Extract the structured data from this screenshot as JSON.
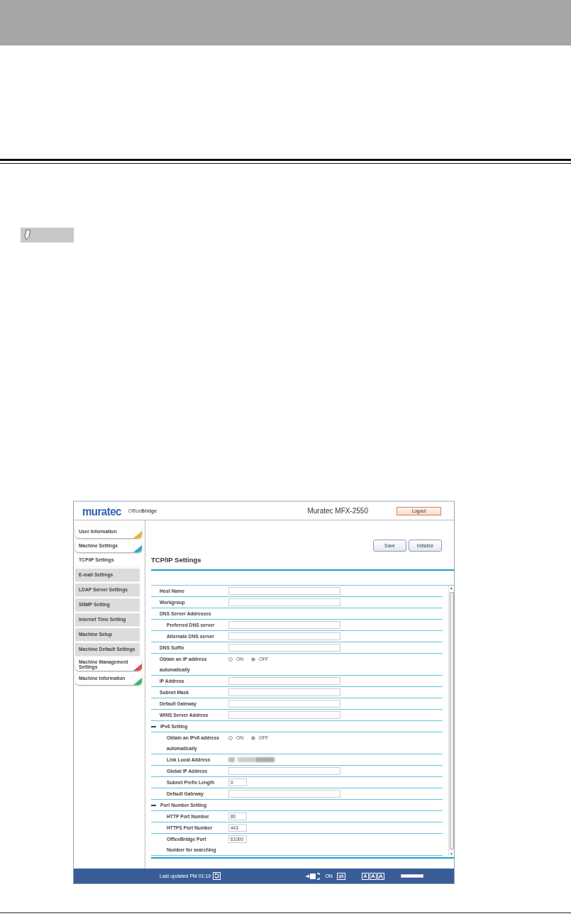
{
  "window": {
    "logo": "muratec",
    "product": "Office**Bridge**",
    "model": "Muratec MFX-2550",
    "logout": "Logout"
  },
  "sidebar": [
    {
      "label": "User Information",
      "color": "#efb12e"
    },
    {
      "label": "Machine Settings",
      "color": "#2ea9cb",
      "children": [
        {
          "label": "TCP/IP Settings",
          "selected": true
        },
        {
          "label": "E-mail Settings",
          "selected": false
        },
        {
          "label": "LDAP Server Settings",
          "selected": false
        },
        {
          "label": "SNMP Setting",
          "selected": false
        },
        {
          "label": "Internet Time Setting",
          "selected": false
        },
        {
          "label": "Machine Setup",
          "selected": false
        },
        {
          "label": "Machine Default Settings",
          "selected": false
        }
      ]
    },
    {
      "label": "Machine Management Settings",
      "color": "#dd4f4f"
    },
    {
      "label": "Machine Information",
      "color": "#3fb56a"
    }
  ],
  "buttons": [
    "Save",
    "Initialize"
  ],
  "title": "TCP/IP Settings",
  "rows": [
    {
      "kind": "field",
      "label": "Host Name"
    },
    {
      "kind": "field",
      "label": "Workgroup"
    },
    {
      "kind": "group",
      "label": "DNS Server Addresses",
      "children": [
        {
          "kind": "field",
          "label": "Preferred DNS server"
        },
        {
          "kind": "field",
          "label": "Alternate DNS server"
        }
      ]
    },
    {
      "kind": "field",
      "label": "DNS Suffix"
    },
    {
      "kind": "radio",
      "label": "Obtain an IP address automatically",
      "options": [
        {
          "label": "ON",
          "selected": false
        },
        {
          "label": "OFF",
          "selected": true
        }
      ]
    },
    {
      "kind": "field",
      "label": "IP Address"
    },
    {
      "kind": "field",
      "label": "Subnet Mask"
    },
    {
      "kind": "field",
      "label": "Default Gateway"
    },
    {
      "kind": "field",
      "label": "WINS Server Address"
    },
    {
      "kind": "section",
      "label": "IPv6 Setting",
      "expanded": true,
      "children": [
        {
          "kind": "radio",
          "label": "Obtain an IPv6 address automatically",
          "options": [
            {
              "label": "ON",
              "selected": false
            },
            {
              "label": "OFF",
              "selected": true
            }
          ]
        },
        {
          "kind": "blurred",
          "label": "Link Local Address"
        },
        {
          "kind": "field",
          "label": "Global IP Address"
        },
        {
          "kind": "number",
          "label": "Subnet Prefix Length",
          "value": "0"
        },
        {
          "kind": "field",
          "label": "Default Gateway"
        }
      ]
    },
    {
      "kind": "section",
      "label": "Port Number Setting",
      "expanded": true,
      "children": [
        {
          "kind": "number",
          "label": "HTTP Port Number",
          "value": "80"
        },
        {
          "kind": "number",
          "label": "HTTPS Port Number",
          "value": "443"
        },
        {
          "kind": "number",
          "label": "OfficeBridge Port Number for searching",
          "value": "61000"
        }
      ]
    }
  ],
  "scrollbar": {
    "up": "▲",
    "down": "▼"
  },
  "footer": {
    "updated": "Last updated PM 01:10",
    "status": "ON",
    "font_sizes": [
      "A",
      "A",
      "A"
    ],
    "meter": {
      "level": 1
    }
  }
}
